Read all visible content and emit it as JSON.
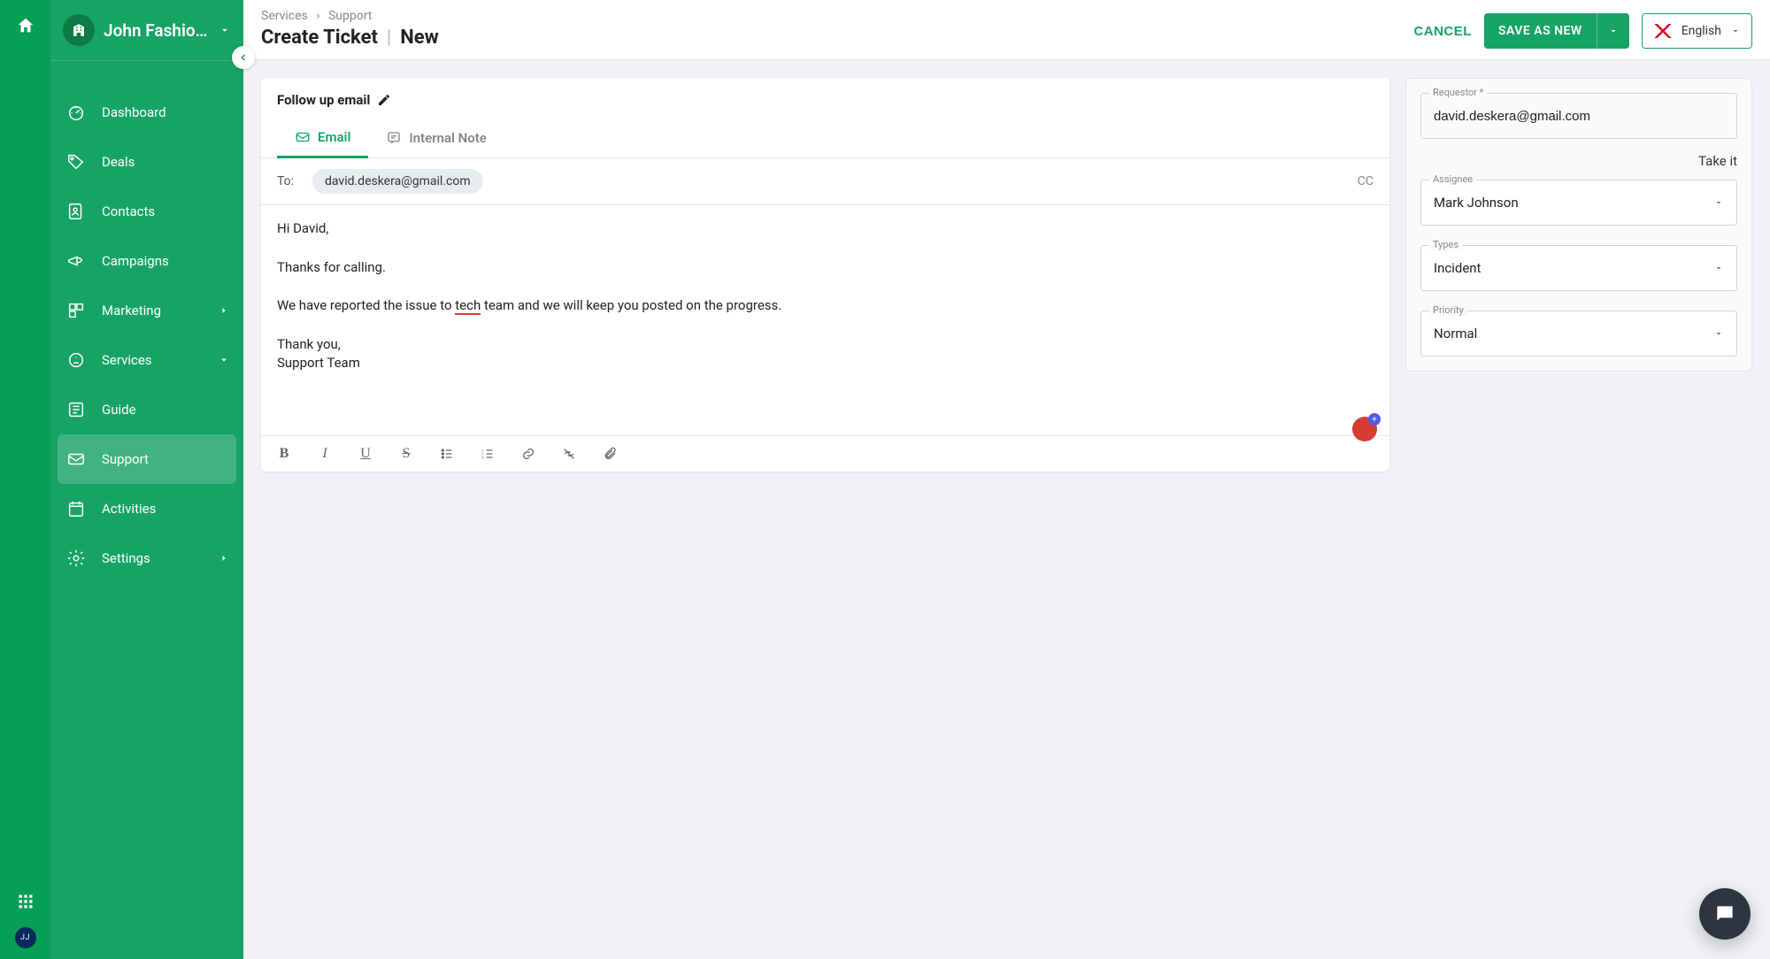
{
  "org": {
    "name": "John Fashio…",
    "avatar_initials": "JJ"
  },
  "breadcrumb": {
    "a": "Services",
    "b": "Support"
  },
  "page": {
    "title_a": "Create Ticket",
    "title_b": "New"
  },
  "actions": {
    "cancel": "CANCEL",
    "save": "SAVE AS NEW"
  },
  "language": {
    "label": "English"
  },
  "nav": {
    "items": [
      {
        "label": "Dashboard"
      },
      {
        "label": "Deals"
      },
      {
        "label": "Contacts"
      },
      {
        "label": "Campaigns"
      },
      {
        "label": "Marketing",
        "expandable": true
      },
      {
        "label": "Services",
        "expandable": true
      },
      {
        "label": "Guide"
      },
      {
        "label": "Support",
        "active": true
      },
      {
        "label": "Activities"
      },
      {
        "label": "Settings",
        "expandable": true
      }
    ]
  },
  "compose": {
    "subject": "Follow up email",
    "tabs": {
      "email": "Email",
      "note": "Internal Note"
    },
    "to_label": "To:",
    "to_chip": "david.deskera@gmail.com",
    "cc": "CC",
    "body_pre": "Hi David,\n\nThanks for calling.\n\nWe have reported the issue to ",
    "body_mis": "tech",
    "body_post": " team and we will keep you posted on the progress.\n\nThank you,\nSupport Team",
    "badge": "+"
  },
  "panel": {
    "requestor_label": "Requestor *",
    "requestor_value": "david.deskera@gmail.com",
    "take_it": "Take it",
    "assignee_label": "Assignee",
    "assignee_value": "Mark Johnson",
    "types_label": "Types",
    "types_value": "Incident",
    "priority_label": "Priority",
    "priority_value": "Normal"
  }
}
